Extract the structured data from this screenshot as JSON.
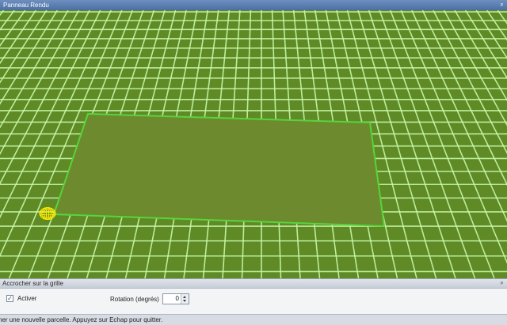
{
  "render_panel": {
    "title": "Panneau Rendu",
    "pin_glyph": "ᵖ"
  },
  "viewport": {
    "ground_color": "#5f8a26",
    "grid_line_color": "#c8f7a8",
    "parcel_fill": "#6d8a2e",
    "parcel_border_color": "#58d43a",
    "cursor_color": "#ffea00",
    "cursor_icon": "wireframe-sphere-icon"
  },
  "snap_panel": {
    "title": "Accrocher sur la grille",
    "pin_glyph": "ᵖ",
    "enable_label": "Activer",
    "enable_checked": true,
    "check_glyph": "✓",
    "rotation_label": "Rotation (degrés)",
    "rotation_value": "0"
  },
  "status_bar": {
    "text": "ner une nouvelle parcelle. Appuyez sur Echap pour quitter."
  }
}
